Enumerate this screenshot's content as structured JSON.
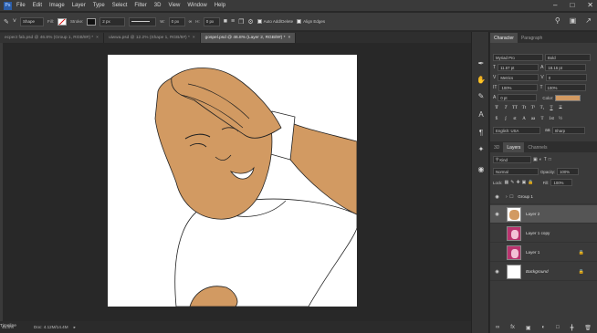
{
  "menubar": {
    "logo": "Ps",
    "items": [
      "File",
      "Edit",
      "Image",
      "Layer",
      "Type",
      "Select",
      "Filter",
      "3D",
      "View",
      "Window",
      "Help"
    ]
  },
  "options": {
    "shape_mode": "Shape",
    "fill_label": "Fill:",
    "stroke_label": "Stroke:",
    "stroke_width": "2 px",
    "w_label": "W:",
    "w_value": "0 px",
    "h_label": "H:",
    "h_value": "0 px",
    "auto_add_delete": "Auto Add/Delete",
    "align_edges": "Align Edges"
  },
  "doc_tabs": [
    "ecpect fab.psd @ 46.8% (Group 1, RGB/8#) *",
    "uiwwa.psd @ 12.2% (Shape 1, RGB/8#) *",
    "gospel.psd @ 46.8% (Layer 2, RGB/8#) *"
  ],
  "active_tab_index": 2,
  "status": {
    "zoom": "46.8%",
    "doc": "Doc: 4.12M/14.4M",
    "timeline": "Timeline"
  },
  "character": {
    "tab_character": "Character",
    "tab_paragraph": "Paragraph",
    "font_family": "Myriad Pro",
    "font_style": "Bold",
    "font_size": "11.67 pt",
    "leading": "18.16 pt",
    "kerning": "Metrics",
    "tracking": "0",
    "vscale": "100%",
    "hscale": "100%",
    "baseline": "0 pt",
    "color_label": "Color:",
    "color": "#d29a62",
    "language": "English: USA",
    "aa_prefix": "aa",
    "antialias": "Sharp"
  },
  "layers_panel": {
    "tab_3d": "3D",
    "tab_layers": "Layers",
    "tab_channels": "Channels",
    "filter": "Kind",
    "blend_mode": "Normal",
    "opacity_label": "Opacity:",
    "opacity": "100%",
    "lock_label": "Lock:",
    "fill_label": "Fill:",
    "fill": "100%",
    "layers": [
      {
        "name": "Group 1"
      },
      {
        "name": "Layer 2"
      },
      {
        "name": "Layer 1 copy"
      },
      {
        "name": "Layer 1"
      },
      {
        "name": "Background"
      }
    ]
  },
  "colors": {
    "skin": "#d29a62",
    "panel": "#3a3a3a",
    "workspace": "#282828"
  }
}
